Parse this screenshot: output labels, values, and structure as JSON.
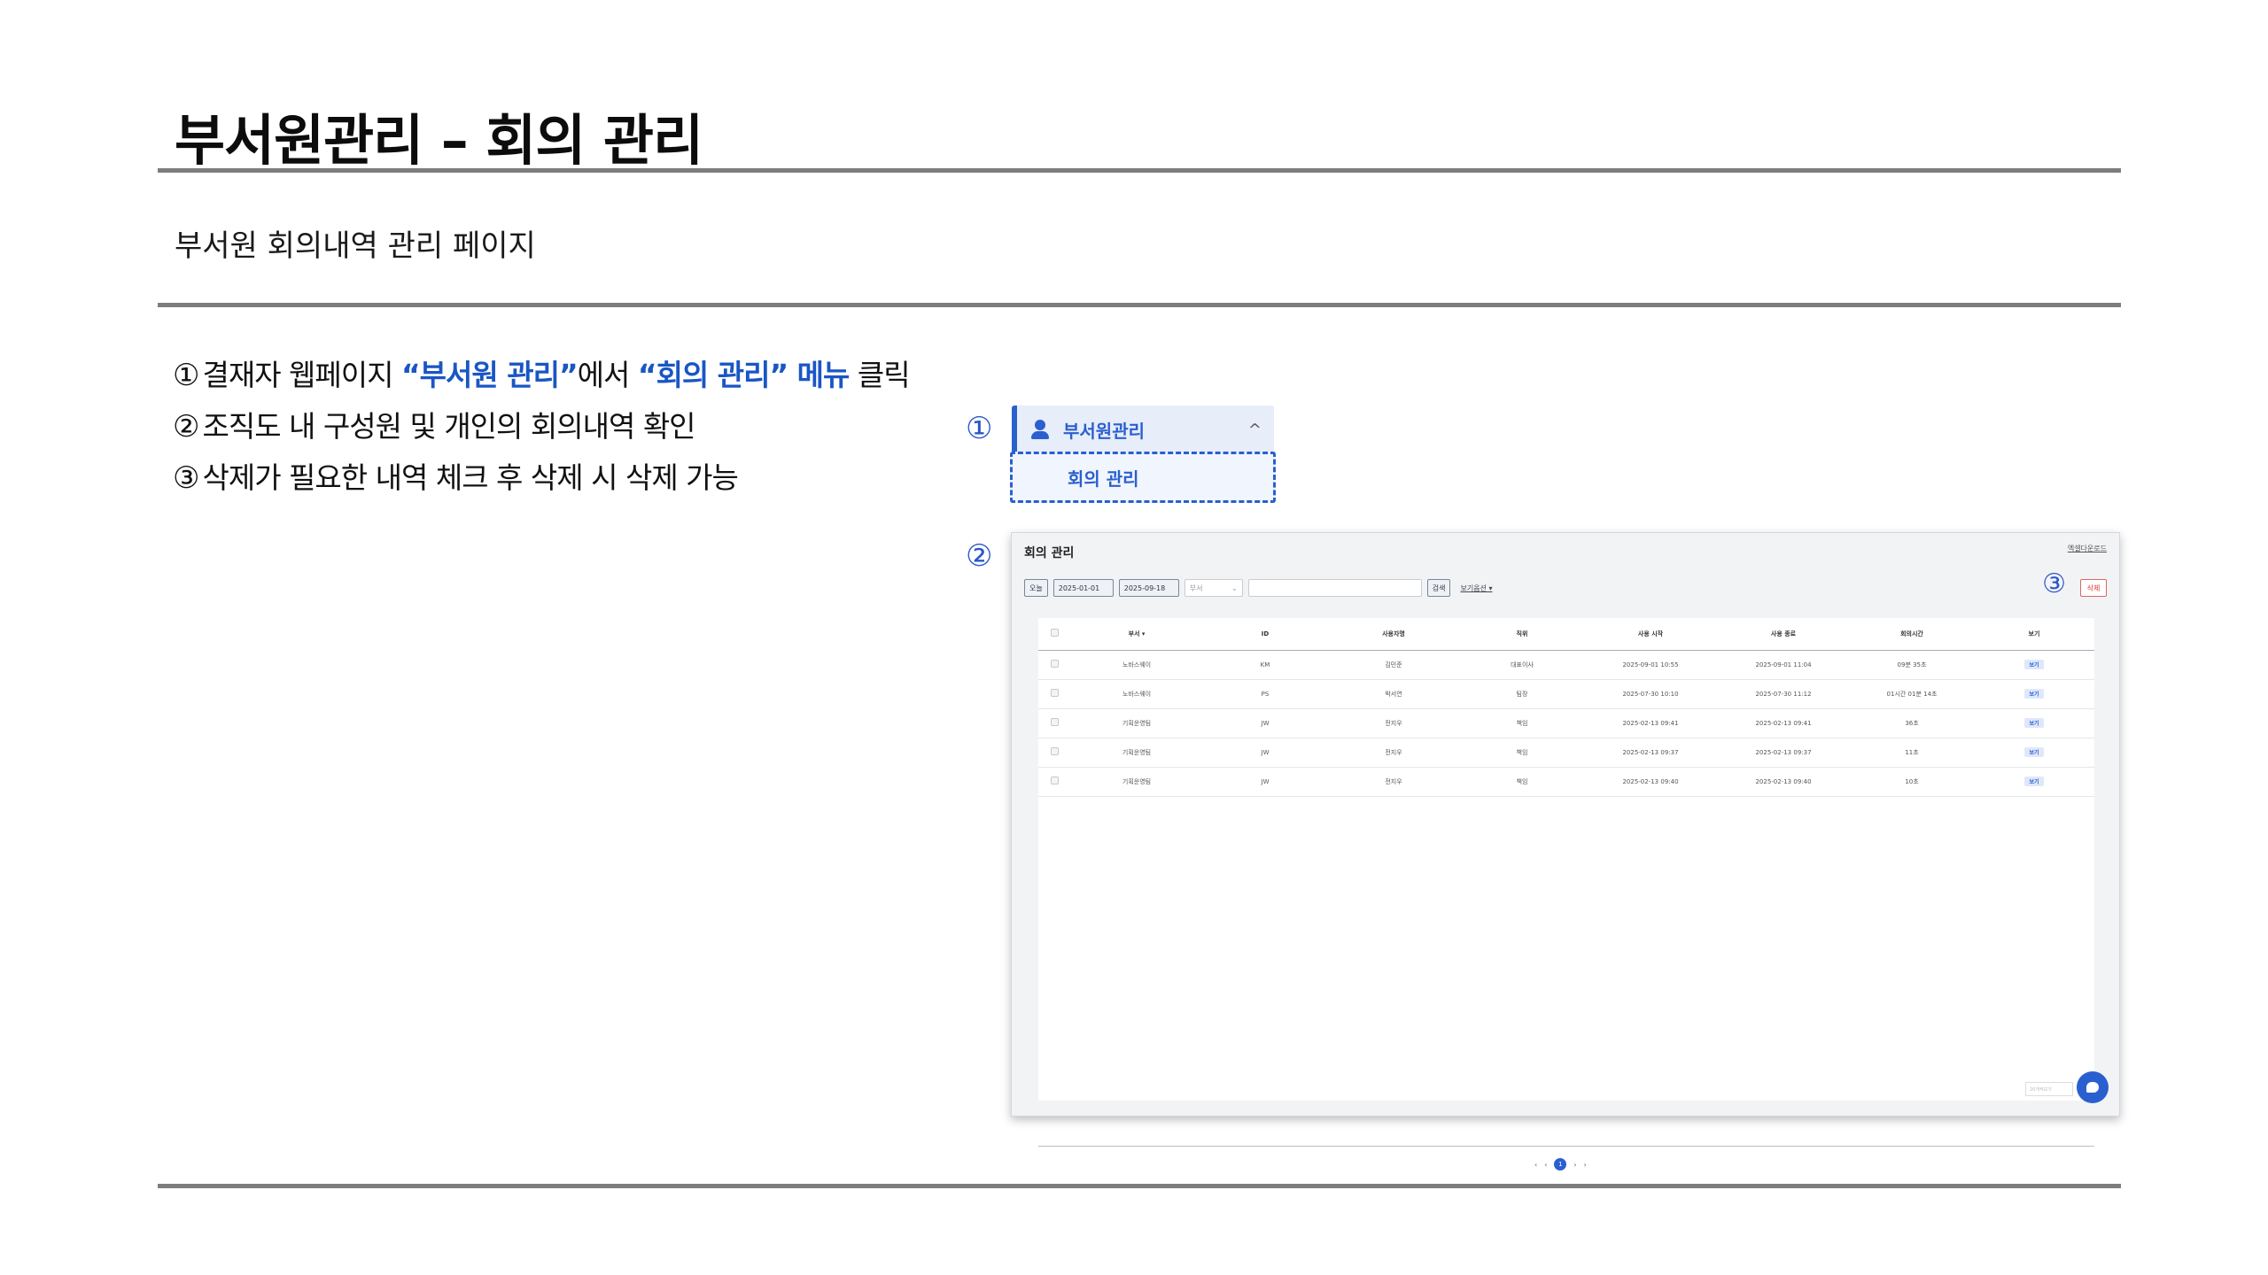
{
  "title": "부서원관리 – 회의 관리",
  "subtitle": "부서원 회의내역 관리 페이지",
  "steps": [
    {
      "num": "①",
      "pre": "결재자 웹페이지 ",
      "hl1": "“부서원 관리”",
      "mid": "에서 ",
      "hl2": "“회의 관리” 메뉴",
      "post": " 클릭"
    },
    {
      "num": "②",
      "text": "조직도 내 구성원 및 개인의 회의내역 확인"
    },
    {
      "num": "③",
      "text": "삭제가 필요한 내역 체크 후 삭제 시 삭제 가능"
    }
  ],
  "markers": {
    "m1": "①",
    "m2": "②",
    "m3": "③"
  },
  "menu": {
    "label": "부서원관리",
    "chevron": "^",
    "submenu": "회의 관리",
    "icon": "person-icon"
  },
  "app": {
    "title": "회의 관리",
    "help_link": "엑셀다운로드",
    "toolbar": {
      "today": "오늘",
      "start_date": "2025-01-01",
      "end_date": "2025-09-18",
      "select": "부서",
      "search": "검색",
      "view_option": "보기옵션 ▾",
      "delete": "삭제"
    },
    "columns": [
      "",
      "부서 ▾",
      "ID",
      "사용자명",
      "직위",
      "사용 시작",
      "사용 종료",
      "회의시간",
      "보기"
    ],
    "rows": [
      {
        "dept": "노바스웨이",
        "id": "KM",
        "name": "김민준",
        "pos": "대표이사",
        "start": "2025-09-01 10:55",
        "end": "2025-09-01 11:04",
        "dur": "09분 35초",
        "view": "보기"
      },
      {
        "dept": "노바스웨이",
        "id": "PS",
        "name": "박서연",
        "pos": "팀장",
        "start": "2025-07-30 10:10",
        "end": "2025-07-30 11:12",
        "dur": "01시간 01분 14초",
        "view": "보기"
      },
      {
        "dept": "기획운영팀",
        "id": "JW",
        "name": "전지우",
        "pos": "책임",
        "start": "2025-02-13 09:41",
        "end": "2025-02-13 09:41",
        "dur": "36초",
        "view": "보기"
      },
      {
        "dept": "기획운영팀",
        "id": "JW",
        "name": "전지우",
        "pos": "책임",
        "start": "2025-02-13 09:37",
        "end": "2025-02-13 09:37",
        "dur": "11초",
        "view": "보기"
      },
      {
        "dept": "기획운영팀",
        "id": "JW",
        "name": "전지우",
        "pos": "책임",
        "start": "2025-02-13 09:40",
        "end": "2025-02-13 09:40",
        "dur": "10초",
        "view": "보기"
      }
    ],
    "pager": {
      "first": "‹",
      "prev": "‹",
      "current": "1",
      "next": "›",
      "last": "›"
    },
    "page_input": "20개씩보기"
  }
}
